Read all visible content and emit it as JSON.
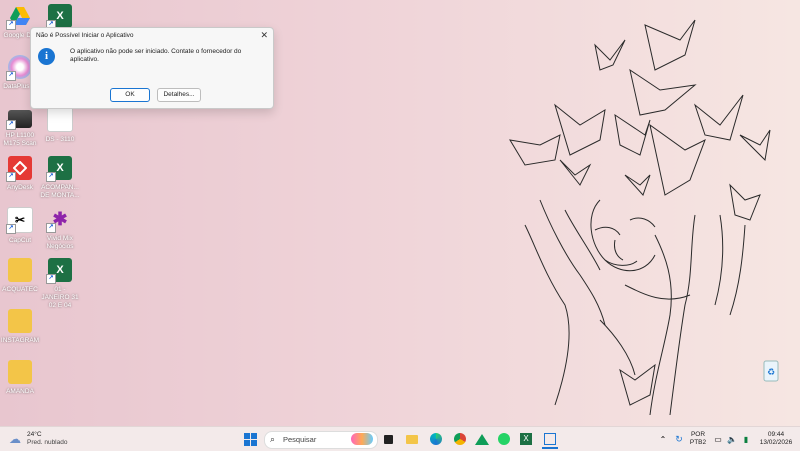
{
  "desktop": {
    "icons_col1": [
      {
        "label": "Google D..."
      },
      {
        "label": "DataPlus ..."
      },
      {
        "label": "HP L1100 M175 Scan"
      },
      {
        "label": "AnyDesk"
      },
      {
        "label": "CapCut"
      },
      {
        "label": "ACQUATEC"
      },
      {
        "label": "INSTAGRAM"
      },
      {
        "label": "AMANDA"
      }
    ],
    "icons_col2": [
      {
        "label": "",
        "type": "excel"
      },
      {
        "label": "DS - 3110",
        "type": "pdf"
      },
      {
        "label": "ACOMPAN... DE MONTA...",
        "type": "excel"
      },
      {
        "label": "Vivid Mix Negócios",
        "type": "vivid"
      },
      {
        "label": "01 - JANEIRO 31 02 E 04",
        "type": "excel"
      }
    ]
  },
  "dialog": {
    "title": "Não é Possível Iniciar o Aplicativo",
    "message": "O aplicativo não pode ser iniciado. Contate o fornecedor do aplicativo.",
    "ok_label": "OK",
    "details_label": "Detalhes..."
  },
  "taskbar": {
    "weather_temp": "24°C",
    "weather_cond": "Pred. nublado",
    "search_placeholder": "Pesquisar",
    "lang_top": "POR",
    "lang_bottom": "PTB2",
    "time": "09:44",
    "date": "13/02/2026"
  },
  "colors": {
    "accent": "#1a75d2",
    "excel": "#1d7044",
    "folder": "#f3c548",
    "taskbar_bg": "#f3eaea"
  }
}
